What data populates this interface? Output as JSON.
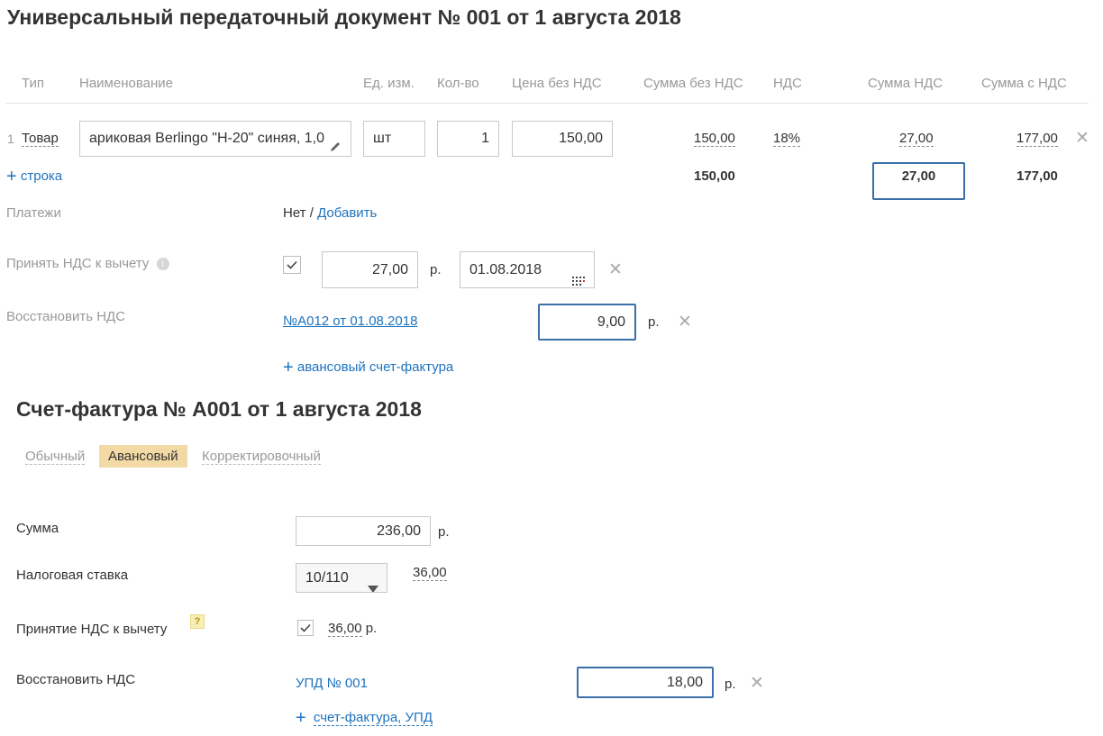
{
  "upd": {
    "title": "Универсальный передаточный документ № 001 от 1 августа 2018",
    "columns": {
      "type": "Тип",
      "name": "Наименование",
      "unit": "Ед. изм.",
      "qty": "Кол-во",
      "price": "Цена без НДС",
      "sum_no_vat": "Сумма без НДС",
      "vat": "НДС",
      "vat_sum": "Сумма НДС",
      "sum_with_vat": "Сумма с НДС"
    },
    "row": {
      "num": "1",
      "type": "Товар",
      "name": "ариковая Berlingo \"H-20\" синяя, 1,0",
      "unit": "шт",
      "qty": "1",
      "price": "150,00",
      "sum_no_vat": "150,00",
      "vat": "18%",
      "vat_sum": "27,00",
      "sum_with_vat": "177,00"
    },
    "add_row": "строка",
    "totals": {
      "sum_no_vat": "150,00",
      "vat_sum": "27,00",
      "sum_with_vat": "177,00"
    },
    "payments": {
      "label": "Платежи",
      "none": "Нет",
      "separator": " / ",
      "add": "Добавить"
    },
    "accept_vat": {
      "label": "Принять НДС к вычету",
      "checked": true,
      "amount": "27,00",
      "currency": "р.",
      "date": "01.08.2018"
    },
    "restore_vat": {
      "label": "Восстановить НДС",
      "doc_link": "№А012 от 01.08.2018",
      "amount": "9,00",
      "currency": "р."
    },
    "add_advance": "авансовый счет-фактура"
  },
  "invoice": {
    "title": "Счет-фактура № А001 от 1 августа 2018",
    "tabs": [
      "Обычный",
      "Авансовый",
      "Корректировочный"
    ],
    "active_tab": "Авансовый",
    "sum": {
      "label": "Сумма",
      "value": "236,00",
      "currency": "р."
    },
    "tax_rate": {
      "label": "Налоговая ставка",
      "selected": "10/110",
      "computed": "36,00"
    },
    "accept_vat": {
      "label": "Принятие НДС к вычету",
      "help": "?",
      "checked": true,
      "amount": "36,00",
      "currency": "р."
    },
    "restore_vat": {
      "label": "Восстановить НДС",
      "doc_link": "УПД № 001",
      "amount": "18,00",
      "currency": "р."
    },
    "add_links": "счет-фактура, УПД"
  },
  "colors": {
    "link": "#1e73be",
    "focus_border": "#3a6fa8",
    "active_tab_bg": "#f3d9a4",
    "muted_text": "#999999"
  }
}
